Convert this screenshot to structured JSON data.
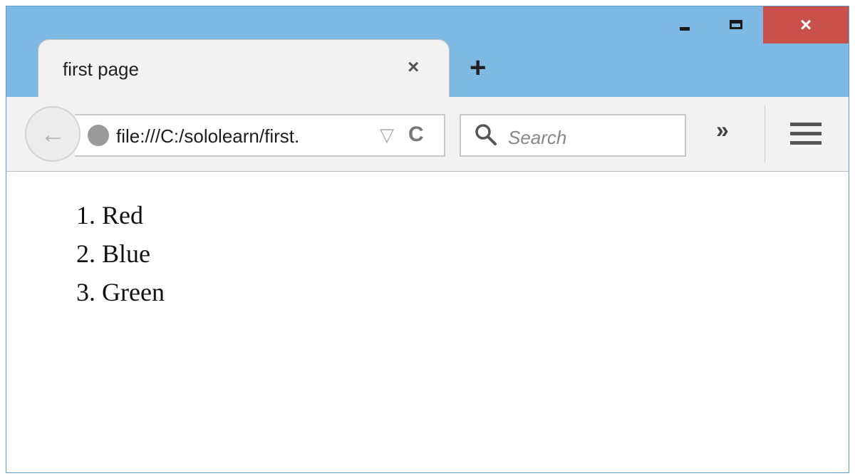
{
  "window": {
    "controls": {
      "minimize_icon": "minimize-icon",
      "maximize_icon": "maximize-icon",
      "close_label": "×"
    }
  },
  "tab": {
    "title": "first page",
    "close_label": "×",
    "new_tab_label": "+"
  },
  "toolbar": {
    "back_label": "←",
    "url": "file:///C:/sololearn/first.",
    "dropdown_label": "▽",
    "reload_label": "C",
    "search_placeholder": "Search",
    "overflow_label": "»",
    "menu_icon": "hamburger-icon"
  },
  "content": {
    "list": [
      {
        "marker": "1.",
        "text": "Red"
      },
      {
        "marker": "2.",
        "text": "Blue"
      },
      {
        "marker": "3.",
        "text": "Green"
      }
    ]
  },
  "colors": {
    "titlebar": "#7db9e2",
    "close_button": "#c9504b",
    "toolbar": "#f2f2f2"
  }
}
